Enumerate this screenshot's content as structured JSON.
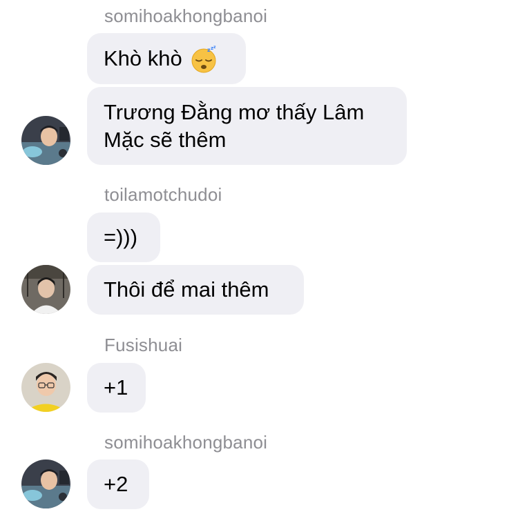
{
  "messages": [
    {
      "sender": "somihoakhongbanoi",
      "text": "Khò khò",
      "emoji": "sleeping-face"
    },
    {
      "text": "Trương Đằng mơ thấy Lâm Mặc sẽ thêm"
    },
    {
      "sender": "toilamotchudoi",
      "text": "=)))"
    },
    {
      "text": "Thôi để mai thêm"
    },
    {
      "sender": "Fusishuai",
      "text": "+1"
    },
    {
      "sender": "somihoakhongbanoi",
      "text": "+2"
    }
  ],
  "colors": {
    "bubble": "#efeff4",
    "sender": "#8e8e93",
    "text": "#000000",
    "emoji": "#f7c244"
  },
  "icons": {
    "avatars": [
      "avatar-somihoakhongbanoi",
      "avatar-toilamotchudoi",
      "avatar-fusishuai",
      "avatar-somihoakhongbanoi"
    ],
    "emoji": "sleeping-face-icon"
  }
}
